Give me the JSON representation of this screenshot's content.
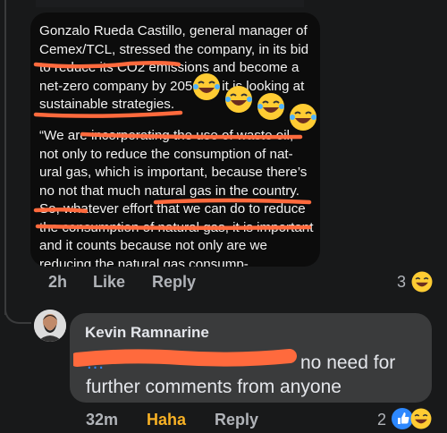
{
  "post_image": {
    "paragraph_1": "Gonzalo Rueda Castillo, general manager of Cemex/TCL, stressed the company, in its bid to reduce its CO2 emissions and become a net-zero company by 2050 as it is looking at sustainable strategies.",
    "paragraph_2": "“We are incorporating the use of waste oil, not only to reduce the consumption of nat-ural gas, which is important, because there’s no not that much natural gas in the country. So, whatever effort that we can do to reduce the consumption of natural gas, it is important and it counts because not only are we reducing the natural gas consump-"
  },
  "comment_1": {
    "time": "2h",
    "like_label": "Like",
    "reply_label": "Reply",
    "reaction_count": "3",
    "reaction_icon": "laughing-face-icon"
  },
  "comment_2": {
    "author": "Kevin Ramnarine",
    "mention": "…",
    "text": "no need for further comments from anyone",
    "time": "32m",
    "reaction_label": "Haha",
    "reply_label": "Reply",
    "reaction_count": "2",
    "reaction_icons": [
      "like-icon",
      "laughing-face-icon"
    ]
  },
  "colors": {
    "background": "#18191a",
    "bubble": "#3a3b3c",
    "annotation_orange": "#ff6a3d",
    "haha": "#f7b125",
    "like_blue": "#2d88ff"
  }
}
